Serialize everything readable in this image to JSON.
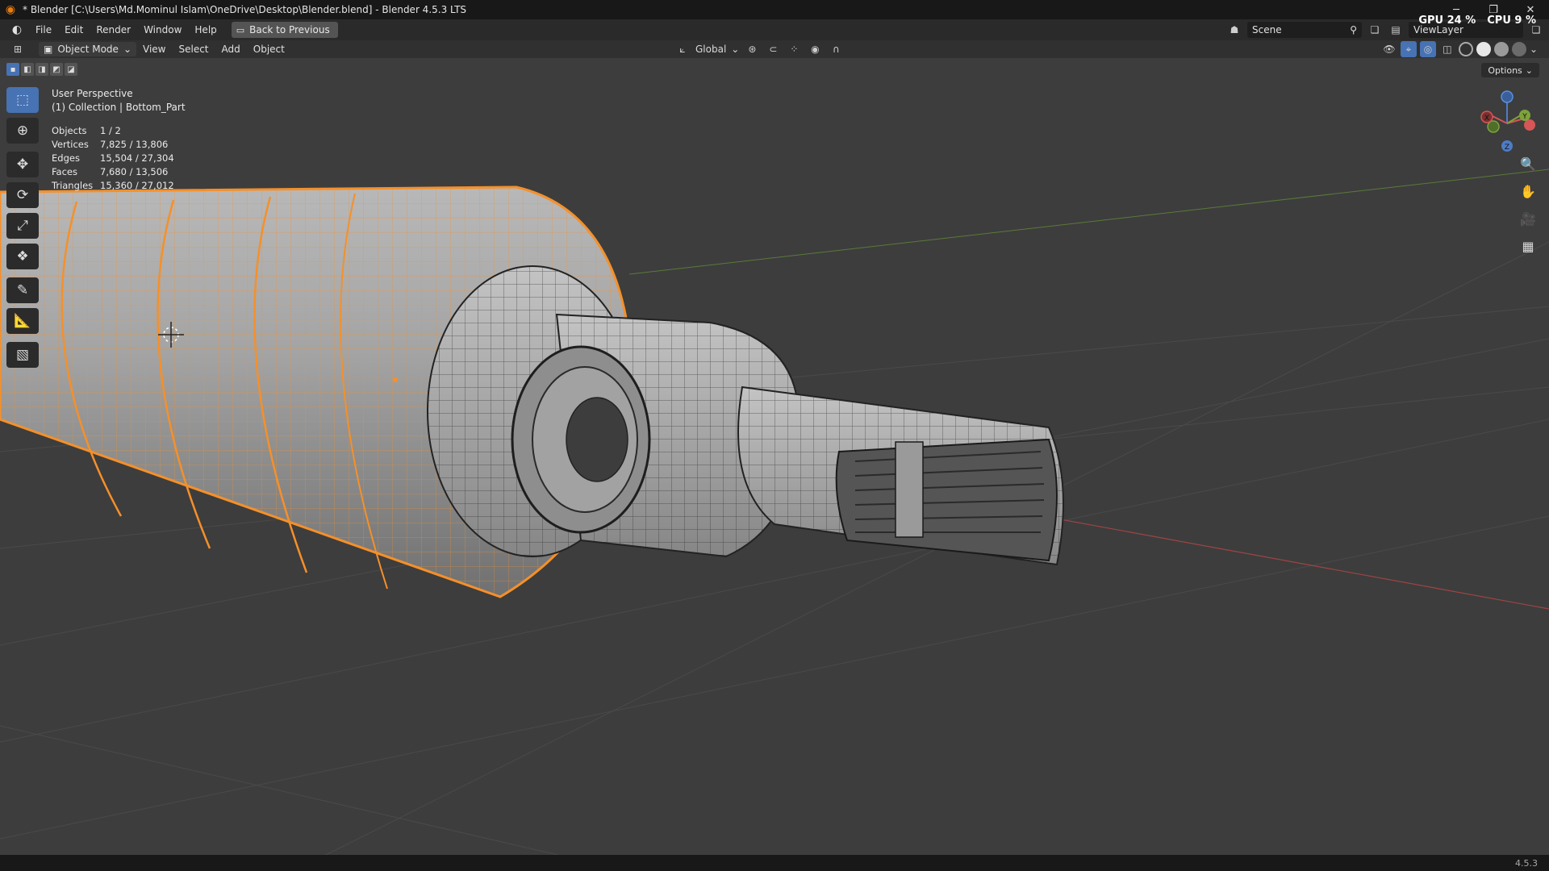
{
  "window": {
    "title": "* Blender [C:\\Users\\Md.Mominul Islam\\OneDrive\\Desktop\\Blender.blend] - Blender 4.5.3 LTS",
    "minimize": "─",
    "maximize": "❐",
    "close": "✕"
  },
  "menu": {
    "items": [
      "File",
      "Edit",
      "Render",
      "Window",
      "Help"
    ],
    "back_button": "Back to Previous"
  },
  "perf": {
    "gpu": "GPU 24 %",
    "cpu": "CPU 9 %"
  },
  "scene": {
    "label": "Scene",
    "view_layer": "ViewLayer"
  },
  "header": {
    "mode": "Object Mode",
    "items": [
      "View",
      "Select",
      "Add",
      "Object"
    ],
    "transform_orientation": "Global",
    "options": "Options"
  },
  "viewport": {
    "perspective": "User Perspective",
    "collection": "(1) Collection | Bottom_Part",
    "stats": [
      {
        "label": "Objects",
        "value": "1 / 2"
      },
      {
        "label": "Vertices",
        "value": "7,825 / 13,806"
      },
      {
        "label": "Edges",
        "value": "15,504 / 27,304"
      },
      {
        "label": "Faces",
        "value": "7,680 / 13,506"
      },
      {
        "label": "Triangles",
        "value": "15,360 / 27,012"
      }
    ],
    "gizmo": {
      "x": "X",
      "y": "Y",
      "z": "Z"
    }
  },
  "status": {
    "version": "4.5.3"
  },
  "colors": {
    "selection": "#f5902a",
    "accent": "#4772b3",
    "background": "#3d3d3d"
  },
  "icons": {
    "select": "cursor-box-icon",
    "cursor": "3d-cursor-icon",
    "move": "move-icon",
    "rotate": "rotate-icon",
    "scale": "scale-icon",
    "transform": "transform-icon",
    "annotate": "annotate-icon",
    "measure": "measure-icon",
    "add_cube": "add-cube-icon"
  }
}
